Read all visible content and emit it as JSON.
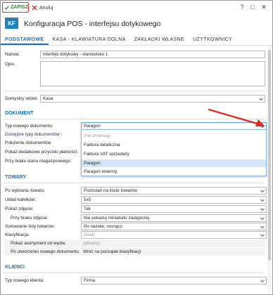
{
  "toolbar": {
    "save_label": "ZAPISZ",
    "cancel_label": "Anuluj"
  },
  "window_controls": [
    "?",
    "□",
    "✕"
  ],
  "header": {
    "logo": "KF",
    "title": "Konfiguracja POS - interfejsu dotykowego"
  },
  "tabs": [
    "PODSTAWOWE",
    "KASA - KLAWIATURA DOLNA",
    "ZAKŁADKI WŁASNE",
    "UŻYTKOWNICY"
  ],
  "general": {
    "name_label": "Nazwa:",
    "name_value": "Interfejs dotykowy - stanowisko 1",
    "desc_label": "Opis:",
    "default_view_label": "Domyślny widok:",
    "default_view_value": "Kasa"
  },
  "document": {
    "section_title": "DOKUMENT",
    "new_doc_type_label": "Typ nowego dokumentu:",
    "new_doc_type_value": "Paragon",
    "available_types_label": "Dostępne typy dokumentów",
    "location_label": "Położenie dokumentów:",
    "extra_buttons_label": "Pokaż dodatkowe przyciski płatności:",
    "no_stock_label": "Przy braku stanu magazynowego:"
  },
  "dropdown_options": [
    {
      "label": "(nie zmieniaj)",
      "placeholder": true
    },
    {
      "label": "Faktura detaliczna"
    },
    {
      "label": "Faktura VAT sprzedaży"
    },
    {
      "label": "Paragon",
      "selected": true
    },
    {
      "label": "Paragon imienny"
    }
  ],
  "goods": {
    "section_title": "TOWARY",
    "after_select_label": "Po wybraniu towaru:",
    "after_select_value": "Pozostań na liście towarów",
    "tiles_label": "Układ kafelków:",
    "tiles_value": "5x5",
    "show_image_label": "Pokaż zdjęcie:",
    "show_image_value": "Tak",
    "no_image_label": "Przy braku zdjęcia:",
    "no_image_value": "Nie pokazuj miniaturki zastępczej",
    "sort_label": "Sortowanie listy towarów:",
    "sort_value": "Po nazwie, rosnąco",
    "classification_label": "Klasyfikacja:",
    "classification_value": "(brak)",
    "show_from_node_label": "Pokaż asortyment od węzła:",
    "show_from_node_value": "(główny)",
    "after_create_label": "Po utworzeniu nowego dokumentu:",
    "after_create_value": "Wróć na początek klasyfikacji"
  },
  "clients": {
    "section_title": "KLIENCI",
    "new_client_type_label": "Typ nowego klienta:",
    "new_client_type_value": "Firma"
  },
  "colors": {
    "accent": "#1f6fb2",
    "logo_bg": "#1f7fc4",
    "save_green": "#2a8a2a",
    "highlight": "#d9302c",
    "selected_row": "#d3e6f8"
  }
}
